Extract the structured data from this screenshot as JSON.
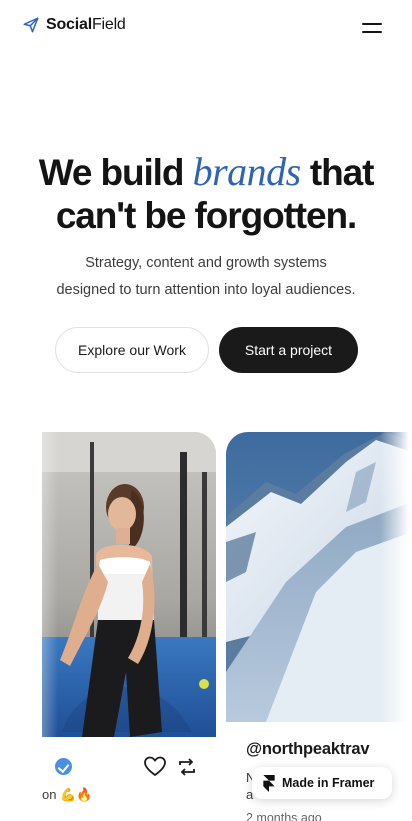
{
  "brand": {
    "name_bold": "Social",
    "name_light": "Field",
    "accent_color": "#2f63b5"
  },
  "hero": {
    "title_before": "We build",
    "title_accent": "brands",
    "title_after": "that",
    "title_line2": "can't be forgotten.",
    "subtitle_line1": "Strategy, content and growth systems",
    "subtitle_line2": "designed to turn attention into loyal audiences."
  },
  "buttons": {
    "explore": "Explore our Work",
    "start": "Start a project"
  },
  "posts": [
    {
      "caption": "on 💪🔥",
      "icons": [
        "verified-icon",
        "heart-icon",
        "repost-icon"
      ]
    },
    {
      "handle": "@northpeaktrav",
      "caption_line1": "N",
      "caption_line2": "a",
      "time": "2 months ago"
    }
  ],
  "badge": {
    "label": "Made in Framer"
  }
}
